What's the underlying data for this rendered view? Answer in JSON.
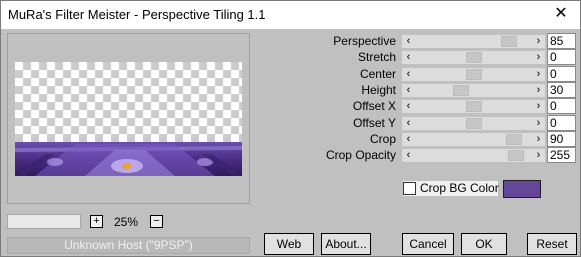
{
  "window": {
    "title": "MuRa's Filter Meister - Perspective Tiling 1.1",
    "close_glyph": "✕"
  },
  "preview": {
    "zoom_minus": "−",
    "zoom_plus": "+",
    "zoom_value": "25%"
  },
  "status_text": "Unknown Host (\"9PSP\")",
  "params": [
    {
      "label": "Perspective",
      "value": "85",
      "level": 0.85
    },
    {
      "label": "Stretch",
      "value": "0",
      "level": 0.5
    },
    {
      "label": "Center",
      "value": "0",
      "level": 0.5
    },
    {
      "label": "Height",
      "value": "30",
      "level": 0.38
    },
    {
      "label": "Offset X",
      "value": "0",
      "level": 0.5
    },
    {
      "label": "Offset Y",
      "value": "0",
      "level": 0.5
    },
    {
      "label": "Crop",
      "value": "90",
      "level": 0.9
    },
    {
      "label": "Crop Opacity",
      "value": "255",
      "level": 0.92
    }
  ],
  "crop_bg": {
    "label": "Crop BG Color",
    "checked": false,
    "color": "#65479a"
  },
  "buttons": {
    "web": "Web",
    "about": "About...",
    "cancel": "Cancel",
    "ok": "OK",
    "reset": "Reset"
  },
  "icons": {
    "close": "close-icon",
    "left": "arrow-left-icon",
    "right": "arrow-right-icon"
  }
}
